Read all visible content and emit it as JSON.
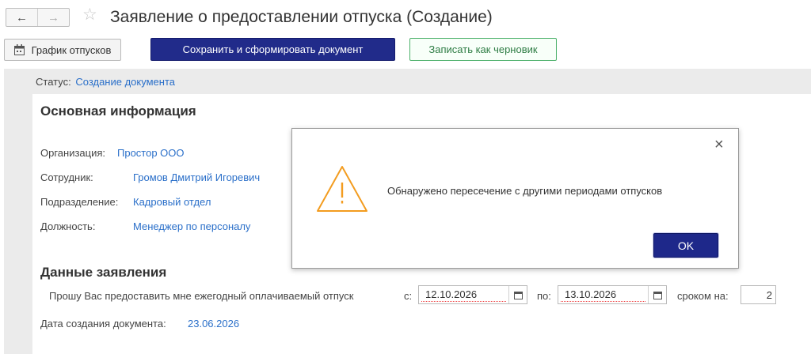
{
  "header": {
    "title": "Заявление о предоставлении отпуска (Создание)",
    "back_icon": "←",
    "forward_icon": "→",
    "star_icon": "☆"
  },
  "toolbar": {
    "schedule_label": "График отпусков",
    "save_label": "Сохранить и сформировать документ",
    "draft_label": "Записать как черновик"
  },
  "status": {
    "label": "Статус:",
    "value": "Создание документа"
  },
  "main_info": {
    "title": "Основная информация",
    "organization_label": "Организация:",
    "organization_value": "Простор ООО",
    "employee_label": "Сотрудник:",
    "employee_value": "Громов Дмитрий Игоревич",
    "department_label": "Подразделение:",
    "department_value": "Кадровый отдел",
    "position_label": "Должность:",
    "position_value": "Менеджер по персоналу"
  },
  "application": {
    "title": "Данные заявления",
    "request_text": "Прошу Вас предоставить мне ежегодный оплачиваемый отпуск",
    "from_label": "с:",
    "from_value": "12.10.2026",
    "to_label": "по:",
    "to_value": "13.10.2026",
    "duration_label": "сроком на:",
    "duration_value": "2",
    "created_label": "Дата создания документа:",
    "created_value": "23.06.2026"
  },
  "dialog": {
    "message": "Обнаружено пересечение с другими периодами отпусков",
    "ok_label": "OK",
    "close_icon": "×"
  },
  "colors": {
    "primary_button": "#212b8a",
    "link": "#2a6fc9",
    "draft_border": "#4cb06a",
    "warning": "#f39c1f"
  }
}
